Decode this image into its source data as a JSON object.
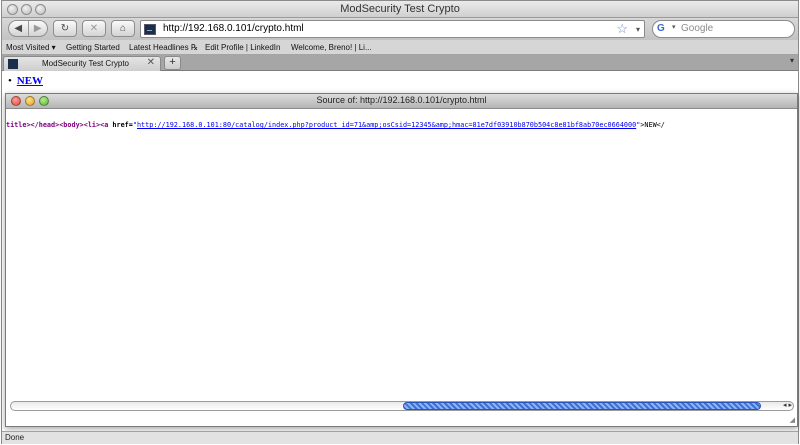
{
  "window": {
    "title": "ModSecurity Test Crypto"
  },
  "toolbar": {
    "back_label": "◀",
    "forward_label": "▶",
    "reload_label": "↻",
    "stop_label": "✕",
    "home_label": "⌂",
    "url": "http://192.168.0.101/crypto.html",
    "bookmark_star": "☆",
    "url_dropdown": "▾",
    "search_engine_label": "G",
    "search_engine_dropdown": "▾",
    "search_placeholder": "Google"
  },
  "bookmarks": {
    "most_visited": "Most Visited ▾",
    "getting_started": "Getting Started",
    "latest_headlines": "Latest Headlines ℞",
    "edit_profile": "Edit Profile | LinkedIn",
    "welcome": "Welcome, Breno! | Li..."
  },
  "tabs": {
    "active_label": "ModSecurity Test Crypto",
    "close_label": "✕",
    "new_tab_label": "+",
    "scroll_label": "▾"
  },
  "page": {
    "list_item_link": "NEW"
  },
  "source_window": {
    "title": "Source of: http://192.168.0.101/crypto.html",
    "code": {
      "t1": "title></head><body><li><a ",
      "attr": "href=",
      "q1": "\"",
      "link": "http://192.168.0.101:80/catalog/index.php?product_id=71&amp;osCsid=12345&amp;hmac=81e7df03910b870b504c8e81bf8ab70ec0664000",
      "q2": "\"",
      "tail": ">NEW</"
    },
    "scroll_arrows": "◂ ▸",
    "resize_grip": "◢"
  },
  "status": {
    "text": "Done"
  },
  "colors": {
    "tag": "#800080",
    "attr_value": "#0000ff",
    "link": "#0000ee",
    "scroll_thumb": "#3d6fd8"
  },
  "icons": {
    "back": "back-arrow-icon",
    "forward": "forward-arrow-icon",
    "reload": "reload-icon",
    "stop": "stop-icon",
    "home": "home-icon",
    "favicon": "site-favicon-icon",
    "star": "bookmark-star-icon",
    "search_engine": "google-icon"
  }
}
